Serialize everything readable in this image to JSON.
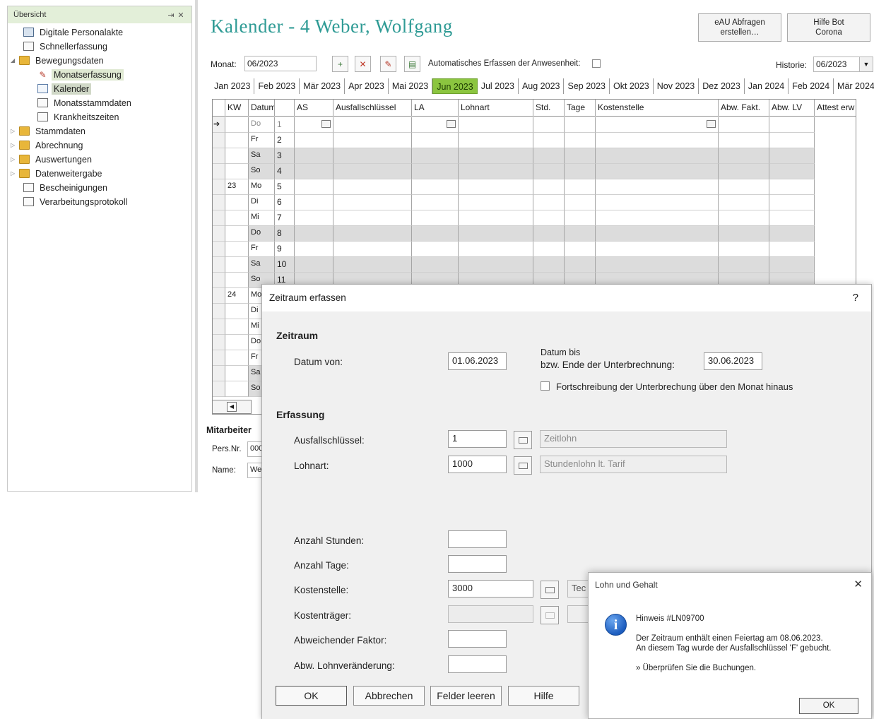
{
  "sidebar": {
    "title": "Übersicht",
    "pin": "⇥",
    "close": "✕",
    "items": [
      {
        "label": "Digitale Personalakte",
        "icon": "personnel-file-icon"
      },
      {
        "label": "Schnellerfassung",
        "icon": "document-icon"
      },
      {
        "label": "Bewegungsdaten",
        "icon": "folder-icon"
      },
      {
        "label": "Monatserfassung",
        "icon": "edit-icon"
      },
      {
        "label": "Kalender",
        "icon": "calendar-icon"
      },
      {
        "label": "Monatsstammdaten",
        "icon": "document-icon"
      },
      {
        "label": "Krankheitszeiten",
        "icon": "document-icon"
      },
      {
        "label": "Stammdaten",
        "icon": "folder-icon"
      },
      {
        "label": "Abrechnung",
        "icon": "folder-icon"
      },
      {
        "label": "Auswertungen",
        "icon": "folder-icon"
      },
      {
        "label": "Datenweitergabe",
        "icon": "folder-icon"
      },
      {
        "label": "Bescheinigungen",
        "icon": "list-icon"
      },
      {
        "label": "Verarbeitungsprotokoll",
        "icon": "protocol-icon"
      }
    ]
  },
  "header": {
    "title": "Kalender - 4 Weber, Wolfgang",
    "eau_button": [
      "eAU Abfragen",
      "erstellen…"
    ],
    "corona_button": [
      "Hilfe Bot",
      "Corona"
    ]
  },
  "toolbar": {
    "monat_label": "Monat:",
    "monat_value": "06/2023",
    "auto_label": "Automatisches Erfassen der Anwesenheit:",
    "historie_label": "Historie:",
    "historie_value": "06/2023"
  },
  "tabs": [
    "Jan 2023",
    "Feb 2023",
    "Mär 2023",
    "Apr 2023",
    "Mai 2023",
    "Jun 2023",
    "Jul 2023",
    "Aug 2023",
    "Sep 2023",
    "Okt 2023",
    "Nov 2023",
    "Dez 2023",
    "Jan 2024",
    "Feb 2024",
    "Mär 2024"
  ],
  "active_tab": "Jun 2023",
  "grid": {
    "columns": [
      "KW",
      "Datum",
      "",
      "AS",
      "Ausfallschlüssel",
      "LA",
      "Lohnart",
      "Std.",
      "Tage",
      "Kostenstelle",
      "Abw. Fakt.",
      "Abw. LV",
      "Attest erw"
    ],
    "rows": [
      {
        "kw": "",
        "day": "Do",
        "date": "1",
        "current": true
      },
      {
        "kw": "",
        "day": "Fr",
        "date": "2"
      },
      {
        "kw": "",
        "day": "Sa",
        "date": "3",
        "weekend": true
      },
      {
        "kw": "",
        "day": "So",
        "date": "4",
        "weekend": true
      },
      {
        "kw": "23",
        "day": "Mo",
        "date": "5"
      },
      {
        "kw": "",
        "day": "Di",
        "date": "6"
      },
      {
        "kw": "",
        "day": "Mi",
        "date": "7"
      },
      {
        "kw": "",
        "day": "Do",
        "date": "8",
        "weekend": true
      },
      {
        "kw": "",
        "day": "Fr",
        "date": "9"
      },
      {
        "kw": "",
        "day": "Sa",
        "date": "10",
        "weekend": true
      },
      {
        "kw": "",
        "day": "So",
        "date": "11",
        "weekend": true
      },
      {
        "kw": "24",
        "day": "Mo",
        "date": ""
      },
      {
        "kw": "",
        "day": "Di",
        "date": ""
      },
      {
        "kw": "",
        "day": "Mi",
        "date": ""
      },
      {
        "kw": "",
        "day": "Do",
        "date": ""
      },
      {
        "kw": "",
        "day": "Fr",
        "date": ""
      },
      {
        "kw": "",
        "day": "Sa",
        "date": "",
        "weekend": true
      },
      {
        "kw": "",
        "day": "So",
        "date": "",
        "weekend": true
      }
    ]
  },
  "employee": {
    "title": "Mitarbeiter",
    "persnr_label": "Pers.Nr.",
    "persnr_value": "000",
    "name_label": "Name:",
    "name_value": "Web"
  },
  "dialog": {
    "title": "Zeitraum erfassen",
    "help": "?",
    "section_zeitraum": "Zeitraum",
    "datum_von_label": "Datum von:",
    "datum_von_value": "01.06.2023",
    "datum_bis_label1": "Datum bis",
    "datum_bis_label2": "bzw. Ende der Unterbrechnung:",
    "datum_bis_value": "30.06.2023",
    "fortschreibung_label": "Fortschreibung der Unterbrechung über den Monat hinaus",
    "section_erfassung": "Erfassung",
    "ausfall_label": "Ausfallschlüssel:",
    "ausfall_value": "1",
    "ausfall_text": "Zeitlohn",
    "lohnart_label": "Lohnart:",
    "lohnart_value": "1000",
    "lohnart_text": "Stundenlohn lt. Tarif",
    "stunden_label": "Anzahl Stunden:",
    "tage_label": "Anzahl Tage:",
    "kostenstelle_label": "Kostenstelle:",
    "kostenstelle_value": "3000",
    "kostenstelle_text": "Tec",
    "kostentraeger_label": "Kostenträger:",
    "faktor_label": "Abweichender Faktor:",
    "lohnveraenderung_label": "Abw. Lohnveränderung:",
    "buttons": [
      "OK",
      "Abbrechen",
      "Felder leeren",
      "Hilfe"
    ]
  },
  "msgbox": {
    "title": "Lohn und Gehalt",
    "close": "✕",
    "icon": "info-icon",
    "heading": "Hinweis #LN09700",
    "line1": "Der Zeitraum enthält einen Feiertag am 08.06.2023.",
    "line2": "An diesem Tag wurde der Ausfallschlüssel 'F' gebucht.",
    "line3": "» Überprüfen Sie die Buchungen.",
    "ok": "OK"
  },
  "colors": {
    "title_teal": "#2f9b95",
    "active_tab_green": "#8bc53f",
    "info_blue": "#1d5dbf"
  }
}
